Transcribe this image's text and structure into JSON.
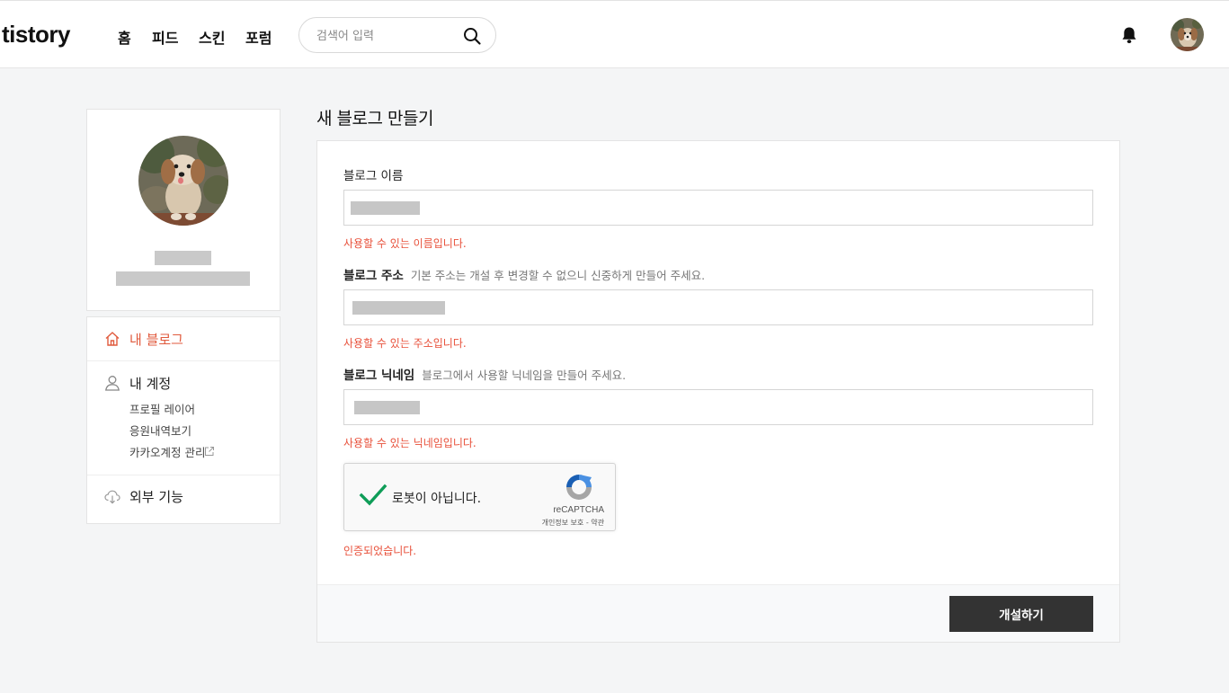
{
  "header": {
    "logo": "tistory",
    "nav": [
      {
        "label": "홈"
      },
      {
        "label": "피드"
      },
      {
        "label": "스킨"
      },
      {
        "label": "포럼"
      }
    ],
    "search_placeholder": "검색어 입력"
  },
  "sidebar": {
    "menu": {
      "my_blog": "내 블로그",
      "my_account": "내 계정",
      "profile_layer": "프로필 레이어",
      "support_history": "응원내역보기",
      "kakao_account": "카카오계정 관리",
      "external": "외부 기능"
    }
  },
  "main": {
    "title": "새 블로그 만들기",
    "fields": {
      "name": {
        "label": "블로그 이름",
        "message": "사용할 수 있는 이름입니다."
      },
      "address": {
        "label": "블로그 주소",
        "hint": "기본 주소는 개설 후 변경할 수 없으니 신중하게 만들어 주세요.",
        "message": "사용할 수 있는 주소입니다."
      },
      "nickname": {
        "label": "블로그 닉네임",
        "hint": "블로그에서 사용할 닉네임을 만들어 주세요.",
        "message": "사용할 수 있는 닉네임입니다."
      }
    },
    "captcha": {
      "label": "로봇이 아닙니다.",
      "brand": "reCAPTCHA",
      "privacy": "개인정보 보호",
      "separator": " - ",
      "terms": "약관",
      "checked": true,
      "message": "인증되었습니다."
    },
    "submit_label": "개설하기"
  },
  "colors": {
    "accent": "#e05a3d",
    "error_text": "#e8503a",
    "button_dark": "#333333",
    "check_green": "#0f9d58"
  }
}
